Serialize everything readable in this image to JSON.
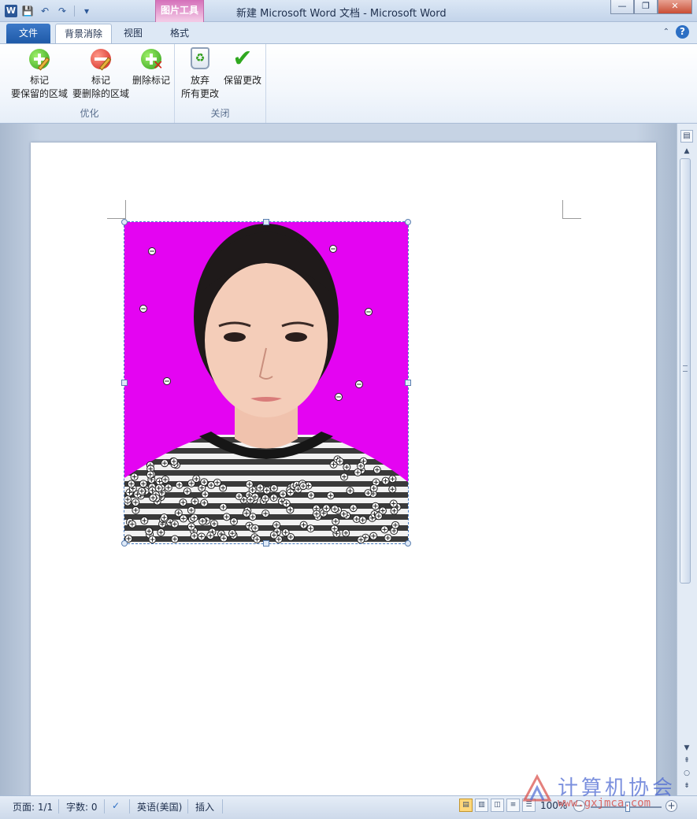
{
  "window": {
    "title": "新建 Microsoft Word 文档  -  Microsoft Word",
    "app_icon": "W",
    "minimize_icon": "—",
    "maximize_icon": "❐",
    "close_icon": "✕"
  },
  "quick_access": {
    "save_icon": "💾",
    "undo_icon": "↶",
    "redo_icon": "↷",
    "customize_icon": "▾"
  },
  "context_tab": {
    "label": "图片工具"
  },
  "tabs": {
    "file": "文件",
    "background_removal": "背景消除",
    "view": "视图",
    "format": "格式"
  },
  "ribbon": {
    "groups": {
      "refine": "优化",
      "close": "关闭"
    },
    "buttons": {
      "mark_keep": {
        "line1": "标记",
        "line2": "要保留的区域"
      },
      "mark_remove": {
        "line1": "标记",
        "line2": "要删除的区域"
      },
      "delete_mark": {
        "line1": "删除标记"
      },
      "discard": {
        "line1": "放弃",
        "line2": "所有更改"
      },
      "keep_changes": {
        "line1": "保留更改"
      }
    },
    "help_icon": "?",
    "minimize_ribbon_icon": "⌃"
  },
  "status_bar": {
    "page": "页面: 1/1",
    "word_count": "字数: 0",
    "proofing_icon": "✓",
    "language": "英语(美国)",
    "insert_mode": "插入",
    "zoom": "100%",
    "zoom_out": "−",
    "zoom_in": "+"
  },
  "scrollbar": {
    "ruler_icon": "▤",
    "up_arrow": "▲",
    "down_arrow": "▼",
    "prev_page": "⇞",
    "select_browse": "○",
    "next_page": "⇟"
  },
  "watermark": {
    "text": "计算机协会",
    "url": "www.gxjmca.com"
  },
  "colors": {
    "photo_background": "#e404f2",
    "file_tab": "#2b65b8",
    "context_tab": "#d46fb9",
    "keep_mark": "#2f9e1a",
    "remove_mark": "#d1211b"
  }
}
